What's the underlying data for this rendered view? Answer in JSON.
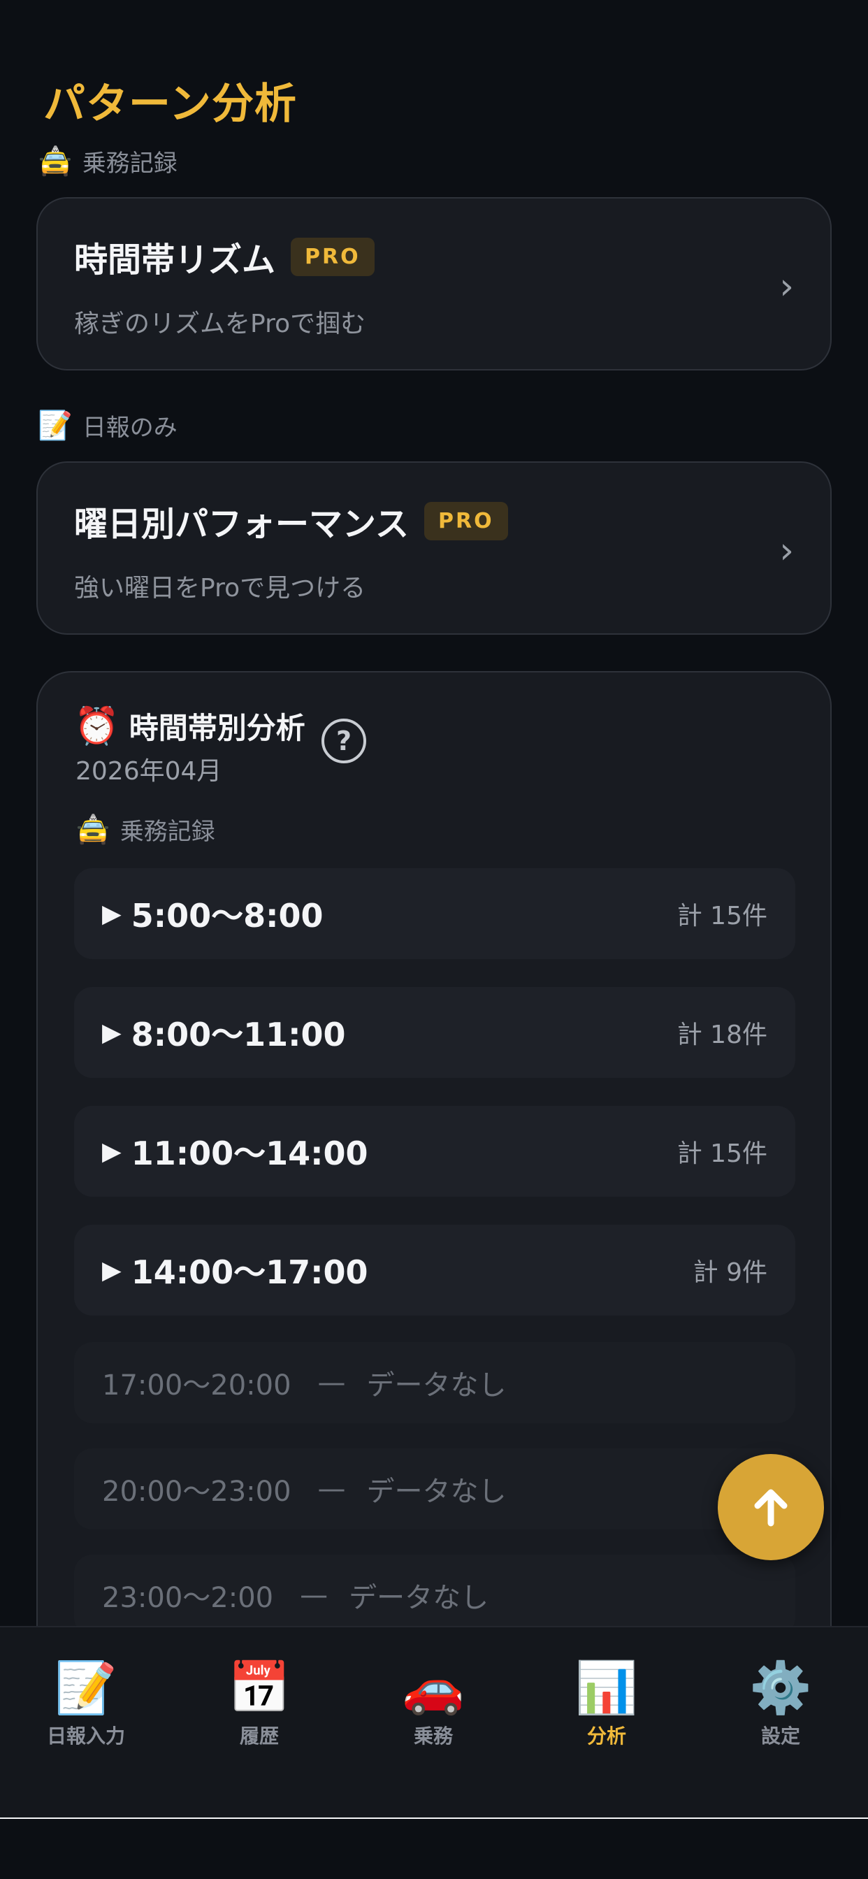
{
  "page": {
    "title": "パターン分析"
  },
  "sections": {
    "ride_label": {
      "emoji": "🚖",
      "text": "乗務記録"
    },
    "daily_label": {
      "emoji": "📝",
      "text": "日報のみ"
    }
  },
  "pro_cards": [
    {
      "title": "時間帯リズム",
      "badge": "PRO",
      "subtitle": "稼ぎのリズムをProで掴む"
    },
    {
      "title": "曜日別パフォーマンス",
      "badge": "PRO",
      "subtitle": "強い曜日をProで見つける"
    }
  ],
  "analysis": {
    "emoji": "⏰",
    "title": "時間帯別分析",
    "help": "?",
    "month": "2026年04月",
    "inner_label": {
      "emoji": "🚖",
      "text": "乗務記録"
    },
    "slots": [
      {
        "range": "5:00〜8:00",
        "count": "計 15件"
      },
      {
        "range": "8:00〜11:00",
        "count": "計 18件"
      },
      {
        "range": "11:00〜14:00",
        "count": "計 15件"
      },
      {
        "range": "14:00〜17:00",
        "count": "計 9件"
      }
    ],
    "empty_slots": [
      {
        "range": "17:00〜20:00",
        "dash": "—",
        "text": "データなし"
      },
      {
        "range": "20:00〜23:00",
        "dash": "—",
        "text": "データなし"
      },
      {
        "range": "23:00〜2:00",
        "dash": "—",
        "text": "データなし"
      }
    ],
    "triangle": "▶"
  },
  "fab": {
    "icon": "arrow-up-icon"
  },
  "tabs": [
    {
      "icon": "📝",
      "label": "日報入力",
      "active": false
    },
    {
      "icon": "📅",
      "label": "履歴",
      "active": false
    },
    {
      "icon": "🚗",
      "label": "乗務",
      "active": false
    },
    {
      "icon": "📊",
      "label": "分析",
      "active": true
    },
    {
      "icon": "⚙️",
      "label": "設定",
      "active": false
    }
  ],
  "colors": {
    "accent": "#f0b93a",
    "fab": "#d8a536",
    "background": "#0c0f14",
    "card": "#181b21"
  }
}
